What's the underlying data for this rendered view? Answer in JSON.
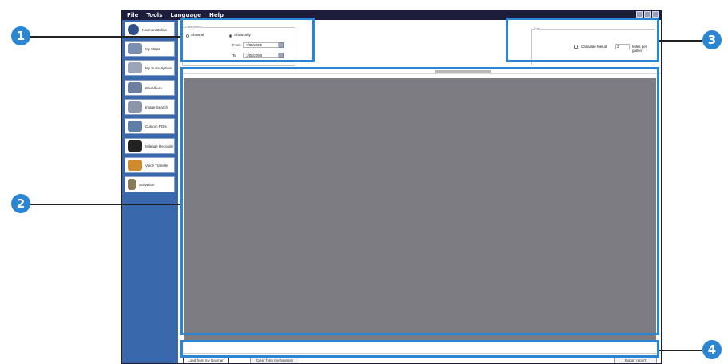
{
  "menu": [
    "File",
    "Tools",
    "Language",
    "Help"
  ],
  "sidebar": {
    "items": [
      {
        "label": "Navman Online",
        "icon": "globe-icon",
        "color": "#2f4f86"
      },
      {
        "label": "My Maps",
        "icon": "maps-icon",
        "color": "#7b8fb2"
      },
      {
        "label": "My Subscriptions",
        "icon": "subscriptions-icon",
        "color": "#9aa5b8"
      },
      {
        "label": "NavAlbum",
        "icon": "album-icon",
        "color": "#6c7fa1"
      },
      {
        "label": "Image Search",
        "icon": "image-search-icon",
        "color": "#8b96a8"
      },
      {
        "label": "Custom POIs",
        "icon": "custom-pois-icon",
        "color": "#5f7ea8"
      },
      {
        "label": "Mileage Recorder",
        "icon": "mileage-icon",
        "color": "#222222"
      },
      {
        "label": "Voice Transfer",
        "icon": "voice-transfer-icon",
        "color": "#d08a2e"
      },
      {
        "label": "Activation",
        "icon": "activation-icon",
        "color": "#8a7a5a"
      }
    ]
  },
  "date_filter": {
    "title": "Date period",
    "show_all": "Show all",
    "show_only": "Show only",
    "from_label": "From",
    "to_label": "To",
    "from_value": "7/04/2009",
    "to_value": "1/05/2009"
  },
  "fuel": {
    "title": "Fuel",
    "calc_label": "Calculate fuel at",
    "value": "2",
    "unit": "Miles per gallon"
  },
  "buttons": {
    "load": "Load from my Navman",
    "clear": "Clear from my Navman",
    "export": "Export report"
  },
  "callouts": [
    "1",
    "2",
    "3",
    "4"
  ],
  "colors": {
    "accent": "#2a86d3",
    "sidebar": "#3a68ad",
    "graph": "#7d7c82"
  }
}
